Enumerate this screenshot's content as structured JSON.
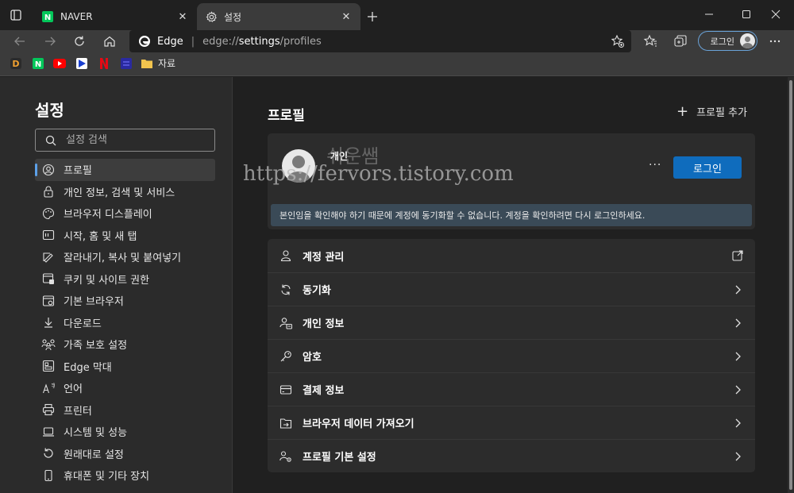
{
  "tabs": [
    {
      "label": "NAVER",
      "close": "✕"
    },
    {
      "label": "설정",
      "close": "✕"
    }
  ],
  "window_controls": {
    "minimize": "minimize-icon",
    "maximize": "maximize-icon",
    "close": "close-icon"
  },
  "address": {
    "brand": "Edge",
    "separator": "|",
    "url_prefix": "edge://",
    "url_host": "settings",
    "url_path": "/profiles"
  },
  "toolbar": {
    "login_label": "로그인"
  },
  "bookmarks": {
    "folder_label": "자료"
  },
  "sidebar": {
    "title": "설정",
    "search_placeholder": "설정 검색",
    "items": [
      {
        "label": "프로필",
        "icon": "profile-icon"
      },
      {
        "label": "개인 정보, 검색 및 서비스",
        "icon": "lock-icon"
      },
      {
        "label": "브라우저 디스플레이",
        "icon": "palette-icon"
      },
      {
        "label": "시작, 홈 및 새 탭",
        "icon": "start-icon"
      },
      {
        "label": "잘라내기, 복사 및 붙여넣기",
        "icon": "clipboard-icon"
      },
      {
        "label": "쿠키 및 사이트 권한",
        "icon": "cookie-icon"
      },
      {
        "label": "기본 브라우저",
        "icon": "browser-icon"
      },
      {
        "label": "다운로드",
        "icon": "download-icon"
      },
      {
        "label": "가족 보호 설정",
        "icon": "family-icon"
      },
      {
        "label": "Edge 막대",
        "icon": "edge-bar-icon"
      },
      {
        "label": "언어",
        "icon": "language-icon"
      },
      {
        "label": "프린터",
        "icon": "printer-icon"
      },
      {
        "label": "시스템 및 성능",
        "icon": "laptop-icon"
      },
      {
        "label": "원래대로 설정",
        "icon": "reset-icon"
      },
      {
        "label": "휴대폰 및 기타 장치",
        "icon": "phone-icon"
      }
    ]
  },
  "main": {
    "title": "프로필",
    "add_profile": "프로필 추가",
    "profile": {
      "name": "개인",
      "more": "···",
      "signin_label": "로그인",
      "notice": "본인임을 확인해야 하기 때문에 계정에 동기화할 수 없습니다. 계정을 확인하려면 다시 로그인하세요."
    },
    "watermark": {
      "line1": "쉬운쌤",
      "line2": "https://fervors.tistory.com"
    },
    "items": [
      {
        "label": "계정 관리",
        "icon": "account-icon",
        "action": "external-link-icon"
      },
      {
        "label": "동기화",
        "icon": "sync-icon",
        "action": "chevron-right-icon"
      },
      {
        "label": "개인 정보",
        "icon": "personal-info-icon",
        "action": "chevron-right-icon"
      },
      {
        "label": "암호",
        "icon": "key-icon",
        "action": "chevron-right-icon"
      },
      {
        "label": "결제 정보",
        "icon": "card-icon",
        "action": "chevron-right-icon"
      },
      {
        "label": "브라우저 데이터 가져오기",
        "icon": "import-icon",
        "action": "chevron-right-icon"
      },
      {
        "label": "프로필 기본 설정",
        "icon": "profile-settings-icon",
        "action": "chevron-right-icon"
      }
    ]
  },
  "colors": {
    "accent": "#0f6cbd",
    "active_indicator": "#5ca0e8",
    "notice_bg": "#3a4a57"
  }
}
